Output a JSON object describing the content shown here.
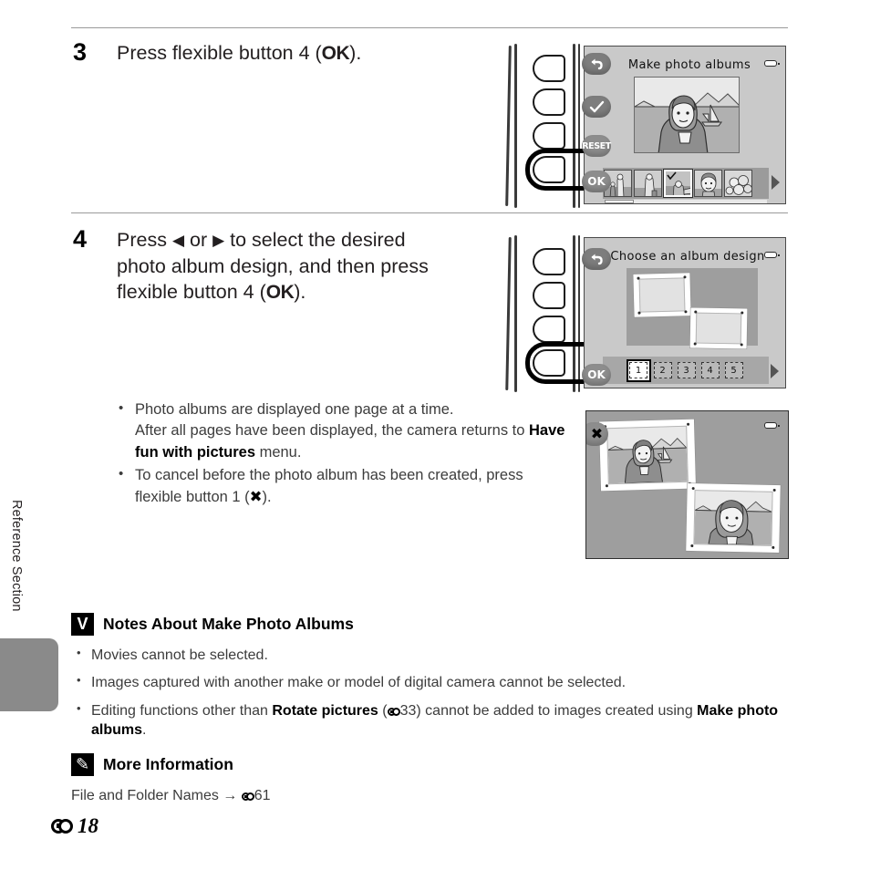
{
  "document": {
    "side_tab_label": "Reference Section",
    "footer_page": "18"
  },
  "steps": [
    {
      "number": "3",
      "text_before": "Press flexible button 4 (",
      "ok_label": "OK",
      "text_after": ")."
    },
    {
      "number": "4",
      "line1_a": "Press ",
      "left_arrow": "◀",
      "line1_b": " or ",
      "right_arrow": "▶",
      "line1_c": " to select the desired",
      "line2": "photo album design, and then press",
      "line3_a": "flexible button 4 (",
      "ok_label": "OK",
      "line3_b": ")."
    }
  ],
  "bullets": [
    {
      "part1": "Photo albums are displayed one page at a time.",
      "part2": "After all pages have been displayed, the camera returns to ",
      "bold": "Have fun with pictures",
      "part3": " menu."
    },
    {
      "part1": "To cancel before the photo album has been created, press",
      "part2": "flexible button 1 (",
      "symbol": "✖",
      "part3": ")."
    }
  ],
  "notes_section": {
    "icon": "warning-v-icon",
    "icon_glyph": "V",
    "title": "Notes About Make Photo Albums",
    "items": [
      {
        "text": "Movies cannot be selected."
      },
      {
        "text": "Images captured with another make or model of digital camera cannot be selected."
      },
      {
        "prefix": "Editing functions other than ",
        "bold1": "Rotate pictures",
        "mid": " (",
        "ref": "33",
        "suffix": ") cannot be added to images created using ",
        "bold2": "Make photo albums",
        "end": "."
      }
    ]
  },
  "more_info_section": {
    "icon": "pencil-icon",
    "icon_glyph": "✎",
    "title": "More Information",
    "line_prefix": "File and Folder Names ",
    "arrow": "→",
    "ref": "61"
  },
  "illustration_1": {
    "name": "camera-make-photo-albums",
    "screen_title": "Make photo albums",
    "soft_keys": [
      {
        "name": "back-key",
        "glyph": "↶"
      },
      {
        "name": "check-key",
        "glyph": "✔"
      },
      {
        "name": "reset-key",
        "label": "RESET"
      },
      {
        "name": "ok-key",
        "label": "OK"
      }
    ],
    "thumbnails": [
      {
        "selected": false
      },
      {
        "selected": false
      },
      {
        "selected": true
      },
      {
        "selected": false
      },
      {
        "selected": false
      }
    ],
    "highlighted_button_index": 4
  },
  "illustration_2": {
    "name": "camera-choose-album-design",
    "screen_title": "Choose an album design",
    "soft_keys": [
      {
        "name": "back-key",
        "glyph": "↶"
      },
      {
        "name": "ok-key",
        "label": "OK"
      }
    ],
    "design_options": [
      {
        "label": "1",
        "selected": true
      },
      {
        "label": "2",
        "selected": false
      },
      {
        "label": "3",
        "selected": false
      },
      {
        "label": "4",
        "selected": false
      },
      {
        "label": "5",
        "selected": false
      }
    ],
    "highlighted_button_index": 4
  },
  "illustration_3": {
    "name": "album-page-preview",
    "cancel_key_glyph": "✖",
    "photo_count": 2
  },
  "colors": {
    "lcd_background": "#c9c9c9",
    "screen_border": "#4a4a4a",
    "soft_key": "#7d7d7d",
    "body_text": "#3c3c3c",
    "rule": "#9a9a9a",
    "side_tab": "#8a8a8a"
  }
}
